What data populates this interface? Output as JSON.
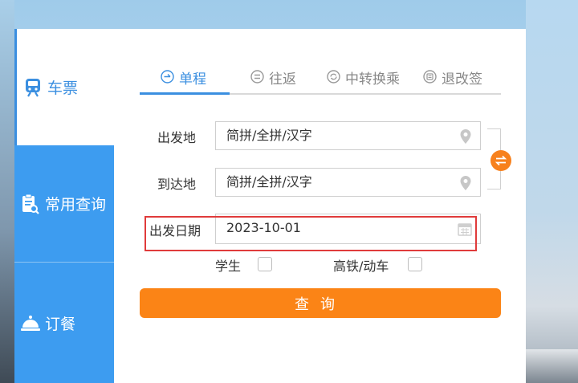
{
  "sidebar": {
    "items": [
      {
        "label": "车票",
        "icon": "train-icon",
        "active": true
      },
      {
        "label": "常用查询",
        "icon": "clipboard-search-icon",
        "active": false
      },
      {
        "label": "订餐",
        "icon": "food-cloche-icon",
        "active": false
      }
    ]
  },
  "tabs": [
    {
      "label": "单程",
      "icon": "arrow-right-circle-icon",
      "active": true
    },
    {
      "label": "往返",
      "icon": "equals-circle-icon",
      "active": false
    },
    {
      "label": "中转换乘",
      "icon": "refresh-circle-icon",
      "active": false
    },
    {
      "label": "退改签",
      "icon": "ticket-circle-icon",
      "active": false
    }
  ],
  "form": {
    "from_label": "出发地",
    "from_placeholder": "简拼/全拼/汉字",
    "to_label": "到达地",
    "to_placeholder": "简拼/全拼/汉字",
    "date_label": "出发日期",
    "date_value": "2023-10-01",
    "student_label": "学生",
    "highspeed_label": "高铁/动车",
    "query_label": "查询"
  },
  "colors": {
    "primary_blue": "#3b8fe0",
    "sidebar_blue": "#3d9cf0",
    "orange": "#fb8416",
    "highlight_red": "#e03b3b"
  }
}
